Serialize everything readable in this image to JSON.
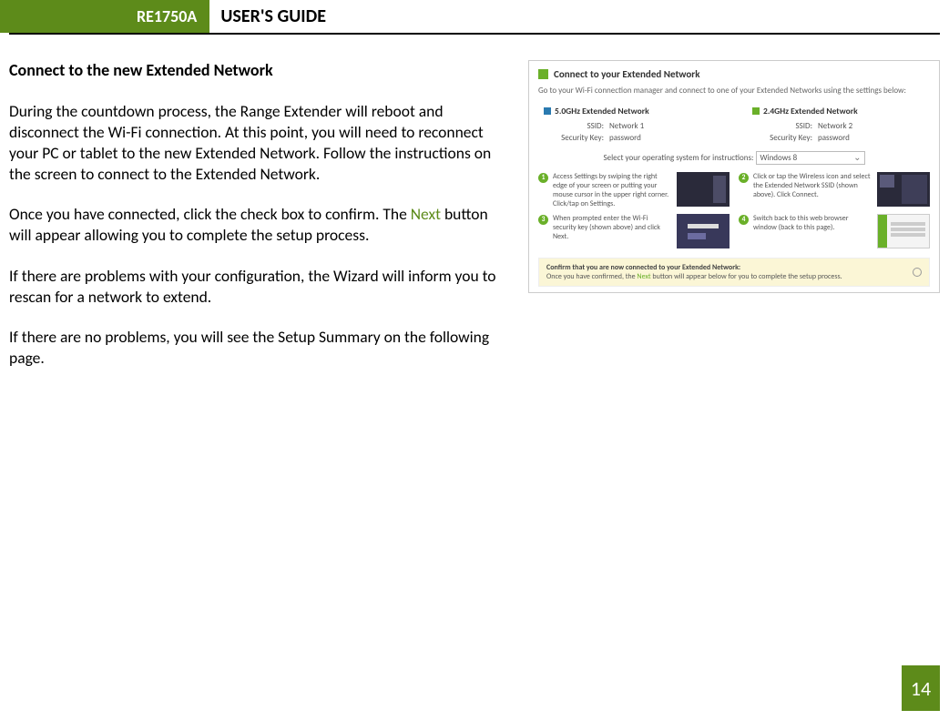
{
  "header": {
    "model": "RE1750A",
    "title": "USER'S GUIDE"
  },
  "body": {
    "heading": "Connect to the new Extended Network",
    "p1": "During the countdown process, the Range Extender will reboot and disconnect the Wi-Fi connection. At this point, you will need to reconnect your PC or tablet to the new Extended Network. Follow the instructions on the screen to connect to the Extended Network.",
    "p2a": "Once you have connected, click the check box to confirm. The ",
    "p2_next": "Next",
    "p2b": " button will appear allowing you to complete the setup process.",
    "p3": "If there are problems with your configuration, the Wizard will inform you to rescan for a network to extend.",
    "p4": "If there are no problems, you will see the Setup Summary on the following page."
  },
  "fig": {
    "title": "Connect to your Extended Network",
    "sub": "Go to your Wi-Fi connection manager and connect to one of your Extended Networks using the settings below:",
    "bands": [
      {
        "label": "5.0GHz Extended Network",
        "ssid_k": "SSID:",
        "ssid_v": "Network 1",
        "key_k": "Security Key:",
        "key_v": "password"
      },
      {
        "label": "2.4GHz Extended Network",
        "ssid_k": "SSID:",
        "ssid_v": "Network 2",
        "key_k": "Security Key:",
        "key_v": "password"
      }
    ],
    "os_label": "Select your operating system for instructions:",
    "os_value": "Windows 8",
    "steps": [
      "Access Settings by swiping the right edge of your screen or putting your mouse cursor in the upper right corner. Click/tap on Settings.",
      "Click or tap the Wireless icon and select the Extended Network SSID (shown above). Click Connect.",
      "When prompted enter the Wi-Fi security key (shown above) and click Next.",
      "Switch back to this web browser window (back to this page)."
    ],
    "confirm_bold": "Confirm that you are now connected to your Extended Network:",
    "confirm_a": "Once you have confirmed, the ",
    "confirm_next": "Next",
    "confirm_b": " button will appear below for you to complete the setup process."
  },
  "page_number": "14"
}
